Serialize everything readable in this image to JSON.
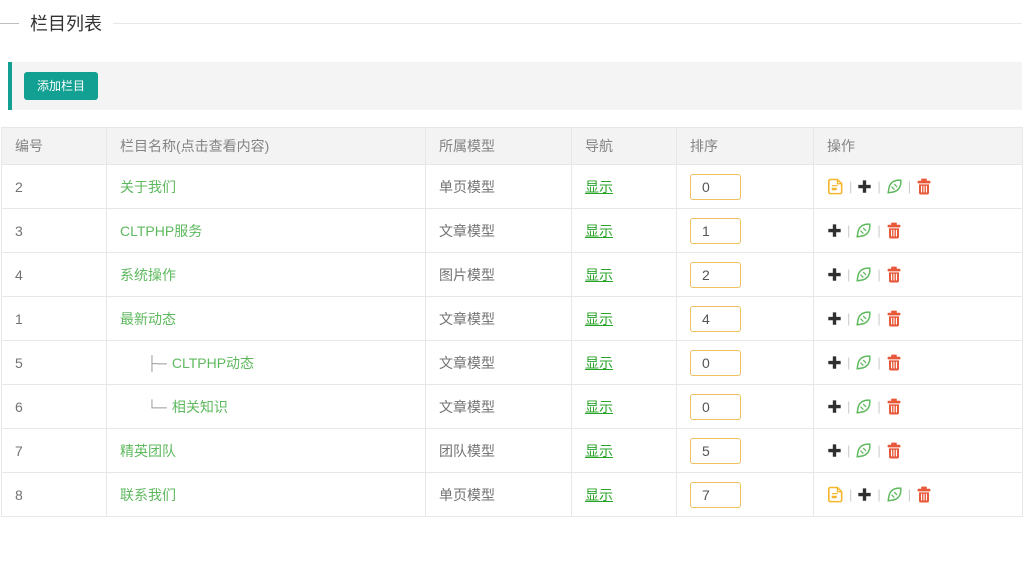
{
  "page": {
    "title": "栏目列表"
  },
  "toolbar": {
    "add_button_label": "添加栏目"
  },
  "table": {
    "columns": [
      "编号",
      "栏目名称(点击查看内容)",
      "所属模型",
      "导航",
      "排序",
      "操作"
    ],
    "rows": [
      {
        "id": "2",
        "tree_prefix": "",
        "name": "关于我们",
        "model": "单页模型",
        "nav": "显示",
        "sort": "0",
        "actions": [
          "content",
          "add",
          "edit",
          "delete"
        ]
      },
      {
        "id": "3",
        "tree_prefix": "",
        "name": "CLTPHP服务",
        "model": "文章模型",
        "nav": "显示",
        "sort": "1",
        "actions": [
          "add",
          "edit",
          "delete"
        ]
      },
      {
        "id": "4",
        "tree_prefix": "",
        "name": "系统操作",
        "model": "图片模型",
        "nav": "显示",
        "sort": "2",
        "actions": [
          "add",
          "edit",
          "delete"
        ]
      },
      {
        "id": "1",
        "tree_prefix": "",
        "name": "最新动态",
        "model": "文章模型",
        "nav": "显示",
        "sort": "4",
        "actions": [
          "add",
          "edit",
          "delete"
        ]
      },
      {
        "id": "5",
        "tree_prefix": "├─",
        "name": "CLTPHP动态",
        "model": "文章模型",
        "nav": "显示",
        "sort": "0",
        "actions": [
          "add",
          "edit",
          "delete"
        ]
      },
      {
        "id": "6",
        "tree_prefix": "└─",
        "name": "相关知识",
        "model": "文章模型",
        "nav": "显示",
        "sort": "0",
        "actions": [
          "add",
          "edit",
          "delete"
        ]
      },
      {
        "id": "7",
        "tree_prefix": "",
        "name": "精英团队",
        "model": "团队模型",
        "nav": "显示",
        "sort": "5",
        "actions": [
          "add",
          "edit",
          "delete"
        ]
      },
      {
        "id": "8",
        "tree_prefix": "",
        "name": "联系我们",
        "model": "单页模型",
        "nav": "显示",
        "sort": "7",
        "actions": [
          "content",
          "add",
          "edit",
          "delete"
        ]
      }
    ]
  },
  "actions": {
    "content": {
      "icon": "document-icon",
      "button_name": "content-edit-button"
    },
    "add": {
      "icon": "plus-icon",
      "button_name": "add-child-button"
    },
    "edit": {
      "icon": "pen-icon",
      "button_name": "edit-button"
    },
    "delete": {
      "icon": "trash-icon",
      "button_name": "delete-button"
    }
  },
  "colors": {
    "accent_teal": "#11a091",
    "toolbar_background": "#f4f4f4",
    "name_link_green": "#5eb95e",
    "nav_link_green": "#28a428",
    "document_icon_yellow": "#f5b62d",
    "plus_icon_black": "#2f2f2f",
    "pen_icon_green": "#5eb95e",
    "trash_icon_red": "#e8593a",
    "sort_input_border": "#f0c060",
    "table_border": "#e7e7e7",
    "header_background": "#f3f3f3"
  }
}
